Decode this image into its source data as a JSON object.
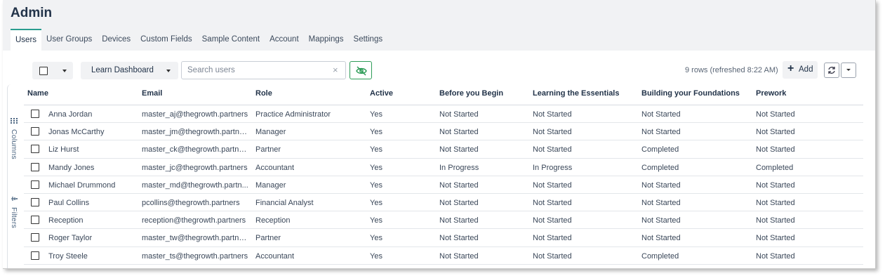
{
  "app": {
    "title": "Admin"
  },
  "tabs": [
    {
      "label": "Users",
      "active": true
    },
    {
      "label": "User Groups"
    },
    {
      "label": "Devices"
    },
    {
      "label": "Custom Fields"
    },
    {
      "label": "Sample Content"
    },
    {
      "label": "Account"
    },
    {
      "label": "Mappings"
    },
    {
      "label": "Settings"
    }
  ],
  "toolbar": {
    "dashboard_select": "Learn Dashboard",
    "search_placeholder": "Search users",
    "search_value": "",
    "clear_glyph": "×",
    "status": "9 rows  (refreshed 8:22 AM)",
    "add_label": "Add",
    "add_glyph": "+",
    "hide_icon": "eye-off-icon",
    "refresh_icon": "refresh-icon",
    "accent_green": "#2e9c58"
  },
  "side_panel": {
    "columns_label": "Columns",
    "filters_label": "Filters"
  },
  "table": {
    "columns": {
      "name": "Name",
      "email": "Email",
      "role": "Role",
      "active": "Active",
      "b1": "Before you Begin",
      "b2": "Learning the Essentials",
      "b3": "Building your Foundations",
      "b4": "Prework"
    },
    "rows": [
      {
        "name": "Anna Jordan",
        "email": "master_aj@thegrowth.partners",
        "role": "Practice Administrator",
        "active": "Yes",
        "b1": "Not Started",
        "b2": "Not Started",
        "b3": "Not Started",
        "b4": "Not Started"
      },
      {
        "name": "Jonas McCarthy",
        "email": "master_jm@thegrowth.partners",
        "role": "Manager",
        "active": "Yes",
        "b1": "Not Started",
        "b2": "Not Started",
        "b3": "Not Started",
        "b4": "Not Started"
      },
      {
        "name": "Liz Hurst",
        "email": "master_ck@thegrowth.partners",
        "role": "Partner",
        "active": "Yes",
        "b1": "Not Started",
        "b2": "Not Started",
        "b3": "Completed",
        "b4": "Not Started"
      },
      {
        "name": "Mandy Jones",
        "email": "master_jc@thegrowth.partners",
        "role": "Accountant",
        "active": "Yes",
        "b1": "In Progress",
        "b2": "In Progress",
        "b3": "Completed",
        "b4": "Completed"
      },
      {
        "name": "Michael Drummond",
        "email": "master_md@thegrowth.partn...",
        "role": "Manager",
        "active": "Yes",
        "b1": "Not Started",
        "b2": "Not Started",
        "b3": "Not Started",
        "b4": "Not Started"
      },
      {
        "name": "Paul Collins",
        "email": "pcollins@thegrowth.partners",
        "role": "Financial Analyst",
        "active": "Yes",
        "b1": "Not Started",
        "b2": "Not Started",
        "b3": "Not Started",
        "b4": "Not Started"
      },
      {
        "name": "Reception",
        "email": "reception@thegrowth.partners",
        "role": "Reception",
        "active": "Yes",
        "b1": "Not Started",
        "b2": "Not Started",
        "b3": "Not Started",
        "b4": "Not Started"
      },
      {
        "name": "Roger Taylor",
        "email": "master_tw@thegrowth.partners",
        "role": "Partner",
        "active": "Yes",
        "b1": "Not Started",
        "b2": "Not Started",
        "b3": "Not Started",
        "b4": "Not Started"
      },
      {
        "name": "Troy Steele",
        "email": "master_ts@thegrowth.partners",
        "role": "Accountant",
        "active": "Yes",
        "b1": "Not Started",
        "b2": "Not Started",
        "b3": "Completed",
        "b4": "Not Started"
      }
    ]
  }
}
